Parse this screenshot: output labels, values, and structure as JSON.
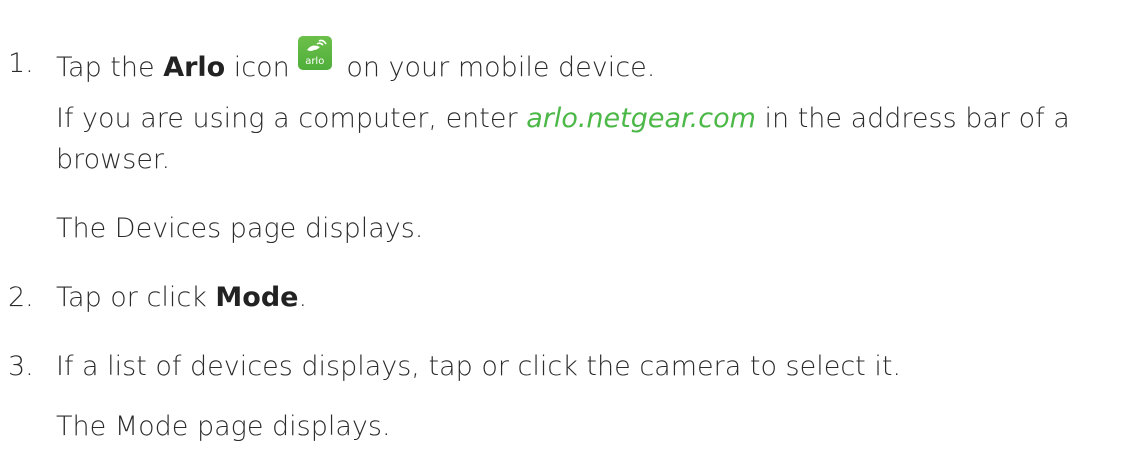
{
  "steps": [
    {
      "number": "1.",
      "pre": "Tap the ",
      "bold": "Arlo",
      "mid": " icon",
      "post": " on your mobile device.",
      "icon_name": "arlo-app-icon",
      "icon_text": "arlo",
      "note_pre": "If you are using a computer, enter ",
      "note_link": "arlo.netgear.com",
      "note_post": " in the address bar of a",
      "note_line2": "browser.",
      "result": "The Devices page displays."
    },
    {
      "number": "2.",
      "pre": "Tap or click ",
      "bold": "Mode",
      "post": "."
    },
    {
      "number": "3.",
      "text": "If a list of devices displays, tap or click the camera to select it.",
      "result": "The Mode page displays."
    }
  ],
  "colors": {
    "link": "#4cb848",
    "icon_bg": "#5cb848",
    "text": "#2b2b2b"
  }
}
